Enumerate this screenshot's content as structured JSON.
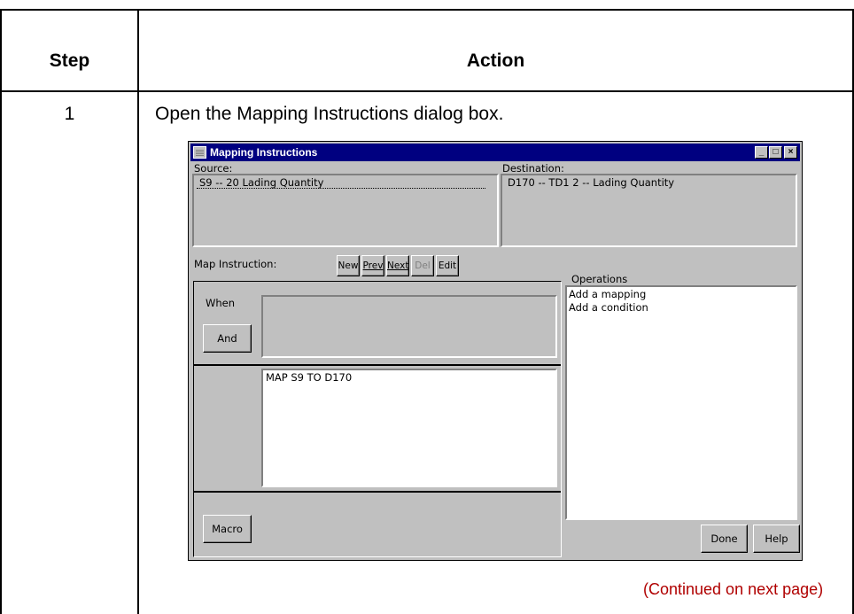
{
  "table": {
    "header_step": "Step",
    "header_action": "Action",
    "row_step": "1",
    "row_action": "Open the Mapping Instructions dialog box.",
    "continued": "(Continued on next page)"
  },
  "dialog": {
    "title": "Mapping Instructions",
    "source_label": "Source:",
    "source_value": "S9 --  20 Lading Quantity",
    "destination_label": "Destination:",
    "destination_value": "D170 -- TD1   2 -- Lading Quantity",
    "map_instruction_label": "Map Instruction:",
    "nav_buttons": [
      "New",
      "Prev",
      "Next",
      "Del",
      "Edit"
    ],
    "when_label": "When",
    "and_button": "And",
    "map_text": "MAP S9 TO D170",
    "macro_button": "Macro",
    "operations_label": "Operations",
    "operations": [
      "Add a mapping",
      "Add a condition"
    ],
    "done_button": "Done",
    "help_button": "Help",
    "window_buttons": [
      "_",
      "□",
      "×"
    ]
  }
}
